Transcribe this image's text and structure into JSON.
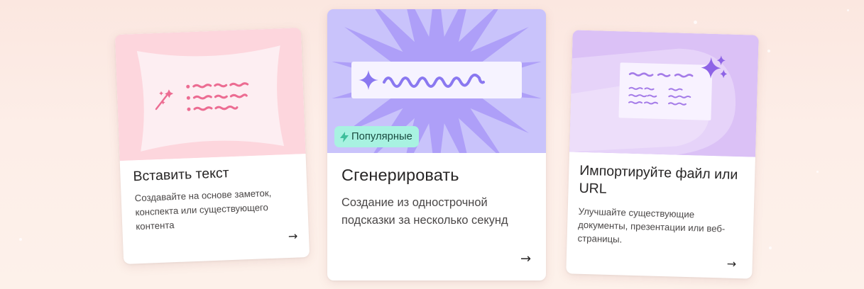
{
  "cards": [
    {
      "id": "paste",
      "title": "Вставить текст",
      "description": "Создавайте на основе заметок, конспекта или существующего контента",
      "arrow": "→",
      "illustration": "paste-text-illustration",
      "accent": "#fdd6dd"
    },
    {
      "id": "generate",
      "title": "Сгенерировать",
      "description": "Создание из однострочной подсказки за несколько секунд",
      "arrow": "→",
      "badge": {
        "icon": "lightning-icon",
        "label": "Популярные",
        "color": "#a8f2e1"
      },
      "illustration": "generate-illustration",
      "accent": "#c9c3fb"
    },
    {
      "id": "import",
      "title": "Импортируйте файл или URL",
      "description": "Улучшайте существующие документы, презентации или веб-страницы.",
      "arrow": "→",
      "illustration": "import-file-illustration",
      "accent": "#dbc1f6"
    }
  ]
}
